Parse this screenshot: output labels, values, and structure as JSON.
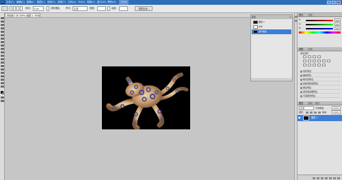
{
  "menubar": {
    "app_logo": "Ps",
    "menus": [
      "文件(F)",
      "编辑(E)",
      "图像(I)",
      "图层(L)",
      "选择(S)",
      "滤镜(T)",
      "分析(A)",
      "3D(D)",
      "视图(V)",
      "窗口(W)",
      "帮助(H)"
    ],
    "zoom": "100%"
  },
  "options": {
    "feather_label": "羽化:",
    "feather_value": "0 px",
    "antialias_label": "消除锯齿",
    "style_label": "样式:",
    "style_value": "正常",
    "width_label": "宽度:",
    "height_label": "高度:",
    "refine_button": "调整边缘..."
  },
  "document": {
    "tab_label": "未标题-1 @ 100% (图层 1, RGB/8)"
  },
  "float_panel": {
    "title": "图层",
    "rows": [
      "图层 1",
      "背景",
      "蓝环章鱼"
    ]
  },
  "color_panel": {
    "tab1": "颜色",
    "tab2": "色板",
    "channels": [
      {
        "label": "R",
        "value": "255",
        "gradient": "#ff0000"
      },
      {
        "label": "G",
        "value": "255",
        "gradient": "#00ff00"
      },
      {
        "label": "B",
        "value": "255",
        "gradient": "#0000ff"
      }
    ]
  },
  "adjust_panel": {
    "tab1": "调整",
    "tab2": "蒙版",
    "heading": "添加调整",
    "presets": [
      "色阶预设",
      "曲线预设",
      "曝光度预设",
      "色相/饱和度预设",
      "黑白预设",
      "通道混合器预设",
      "可选颜色预设"
    ]
  },
  "layers_panel": {
    "tab1": "图层",
    "tab2": "通道",
    "tab3": "路径",
    "blend_mode": "正常",
    "opacity_label": "不透明度:",
    "opacity_value": "100%",
    "lock_label": "锁定:",
    "fill_label": "填充:",
    "fill_value": "100%",
    "layer_name": "图层 1"
  },
  "colors": {
    "title_bar": "#2e6fb8",
    "selection": "#3d7ed6",
    "canvas_bg": "#000000",
    "workspace": "#c6c6c6"
  }
}
